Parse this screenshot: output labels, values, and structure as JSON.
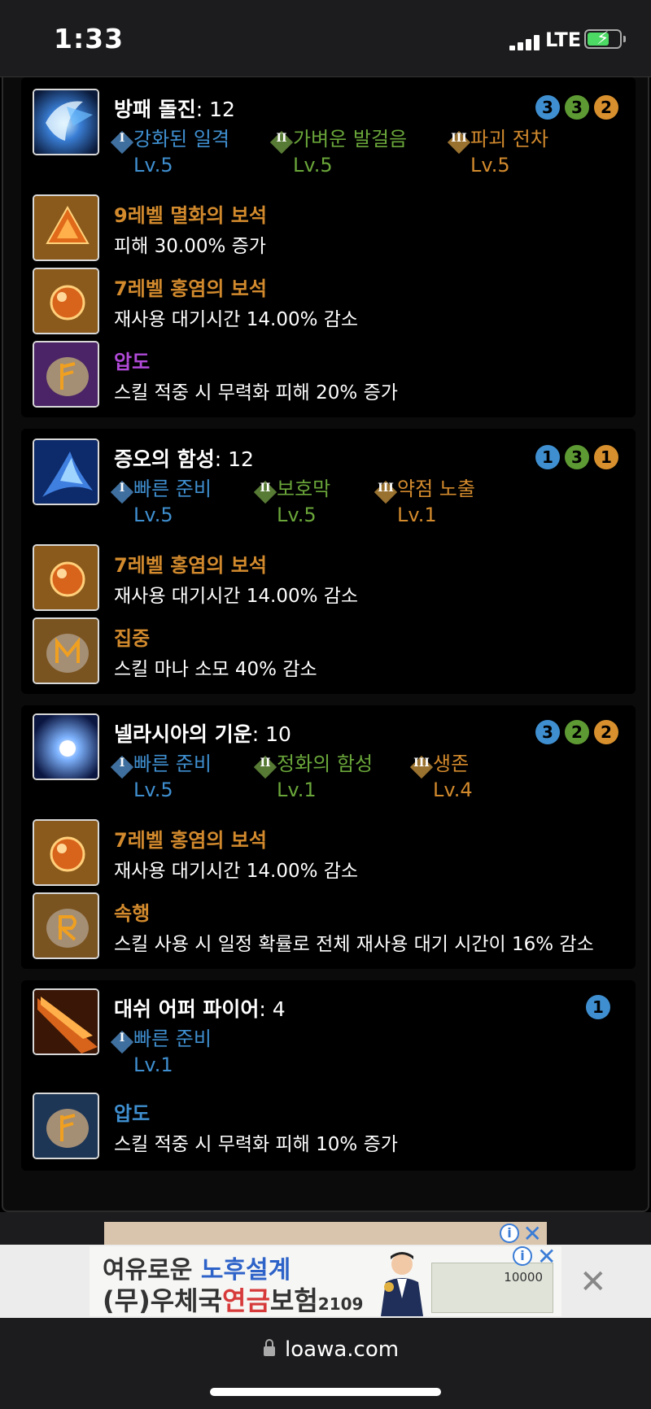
{
  "status": {
    "time": "1:33",
    "network": "LTE"
  },
  "skills": [
    {
      "name": "방패 돌진",
      "level": ": 12",
      "badges": [
        "3",
        "3",
        "2"
      ],
      "tripods": [
        {
          "roman": "I",
          "name": "강화된 일격",
          "lv": "Lv.5",
          "color": "blue"
        },
        {
          "roman": "II",
          "name": "가벼운 발걸음",
          "lv": "Lv.5",
          "color": "green"
        },
        {
          "roman": "III",
          "name": "파괴 전차",
          "lv": "Lv.5",
          "color": "orange"
        }
      ],
      "items": [
        {
          "title": "9레벨 멸화의 보석",
          "desc": "피해 30.00% 증가",
          "icon": "gem-icon"
        },
        {
          "title": "7레벨 홍염의 보석",
          "desc": "재사용 대기시간 14.00% 감소",
          "icon": "gem-icon"
        },
        {
          "title": "압도",
          "desc": "스킬 적중 시 무력화 피해 20% 증가",
          "icon": "rune-icon"
        }
      ]
    },
    {
      "name": "증오의 함성",
      "level": ": 12",
      "badges": [
        "1",
        "3",
        "1"
      ],
      "tripods": [
        {
          "roman": "I",
          "name": "빠른 준비",
          "lv": "Lv.5",
          "color": "blue"
        },
        {
          "roman": "II",
          "name": "보호막",
          "lv": "Lv.5",
          "color": "green"
        },
        {
          "roman": "III",
          "name": "약점 노출",
          "lv": "Lv.1",
          "color": "orange"
        }
      ],
      "items": [
        {
          "title": "7레벨 홍염의 보석",
          "desc": "재사용 대기시간 14.00% 감소",
          "icon": "gem-icon"
        },
        {
          "title": "집중",
          "desc": "스킬 마나 소모 40% 감소",
          "icon": "rune-icon"
        }
      ]
    },
    {
      "name": "넬라시아의 기운",
      "level": ": 10",
      "badges": [
        "3",
        "2",
        "2"
      ],
      "tripods": [
        {
          "roman": "I",
          "name": "빠른 준비",
          "lv": "Lv.5",
          "color": "blue"
        },
        {
          "roman": "II",
          "name": "정화의 함성",
          "lv": "Lv.1",
          "color": "green"
        },
        {
          "roman": "III",
          "name": "생존",
          "lv": "Lv.4",
          "color": "orange"
        }
      ],
      "items": [
        {
          "title": "7레벨 홍염의 보석",
          "desc": "재사용 대기시간 14.00% 감소",
          "icon": "gem-icon"
        },
        {
          "title": "속행",
          "desc": "스킬 사용 시 일정 확률로 전체 재사용 대기 시간이 16% 감소",
          "icon": "rune-icon"
        }
      ]
    },
    {
      "name": "대쉬 어퍼 파이어",
      "level": ": 4",
      "badges": [
        "1"
      ],
      "tripods": [
        {
          "roman": "I",
          "name": "빠른 준비",
          "lv": "Lv.1",
          "color": "blue"
        }
      ],
      "items": [
        {
          "title": "압도",
          "desc": "스킬 적중 시 무력화 피해 10% 증가",
          "icon": "rune-icon"
        }
      ]
    }
  ],
  "ad": {
    "line1_a": "여유로운 ",
    "line1_b": "노후설계",
    "line2_a": "(무)우체국",
    "line2_b": "연금",
    "line2_c": "보험",
    "line2_d": "2109",
    "money_value": "10000",
    "info": "i",
    "close": "✕"
  },
  "browser": {
    "url": "loawa.com"
  },
  "colors": {
    "blue": "#3f8fd0",
    "green": "#6aa63a",
    "orange": "#d28a2d",
    "purple": "#b14ad8"
  }
}
